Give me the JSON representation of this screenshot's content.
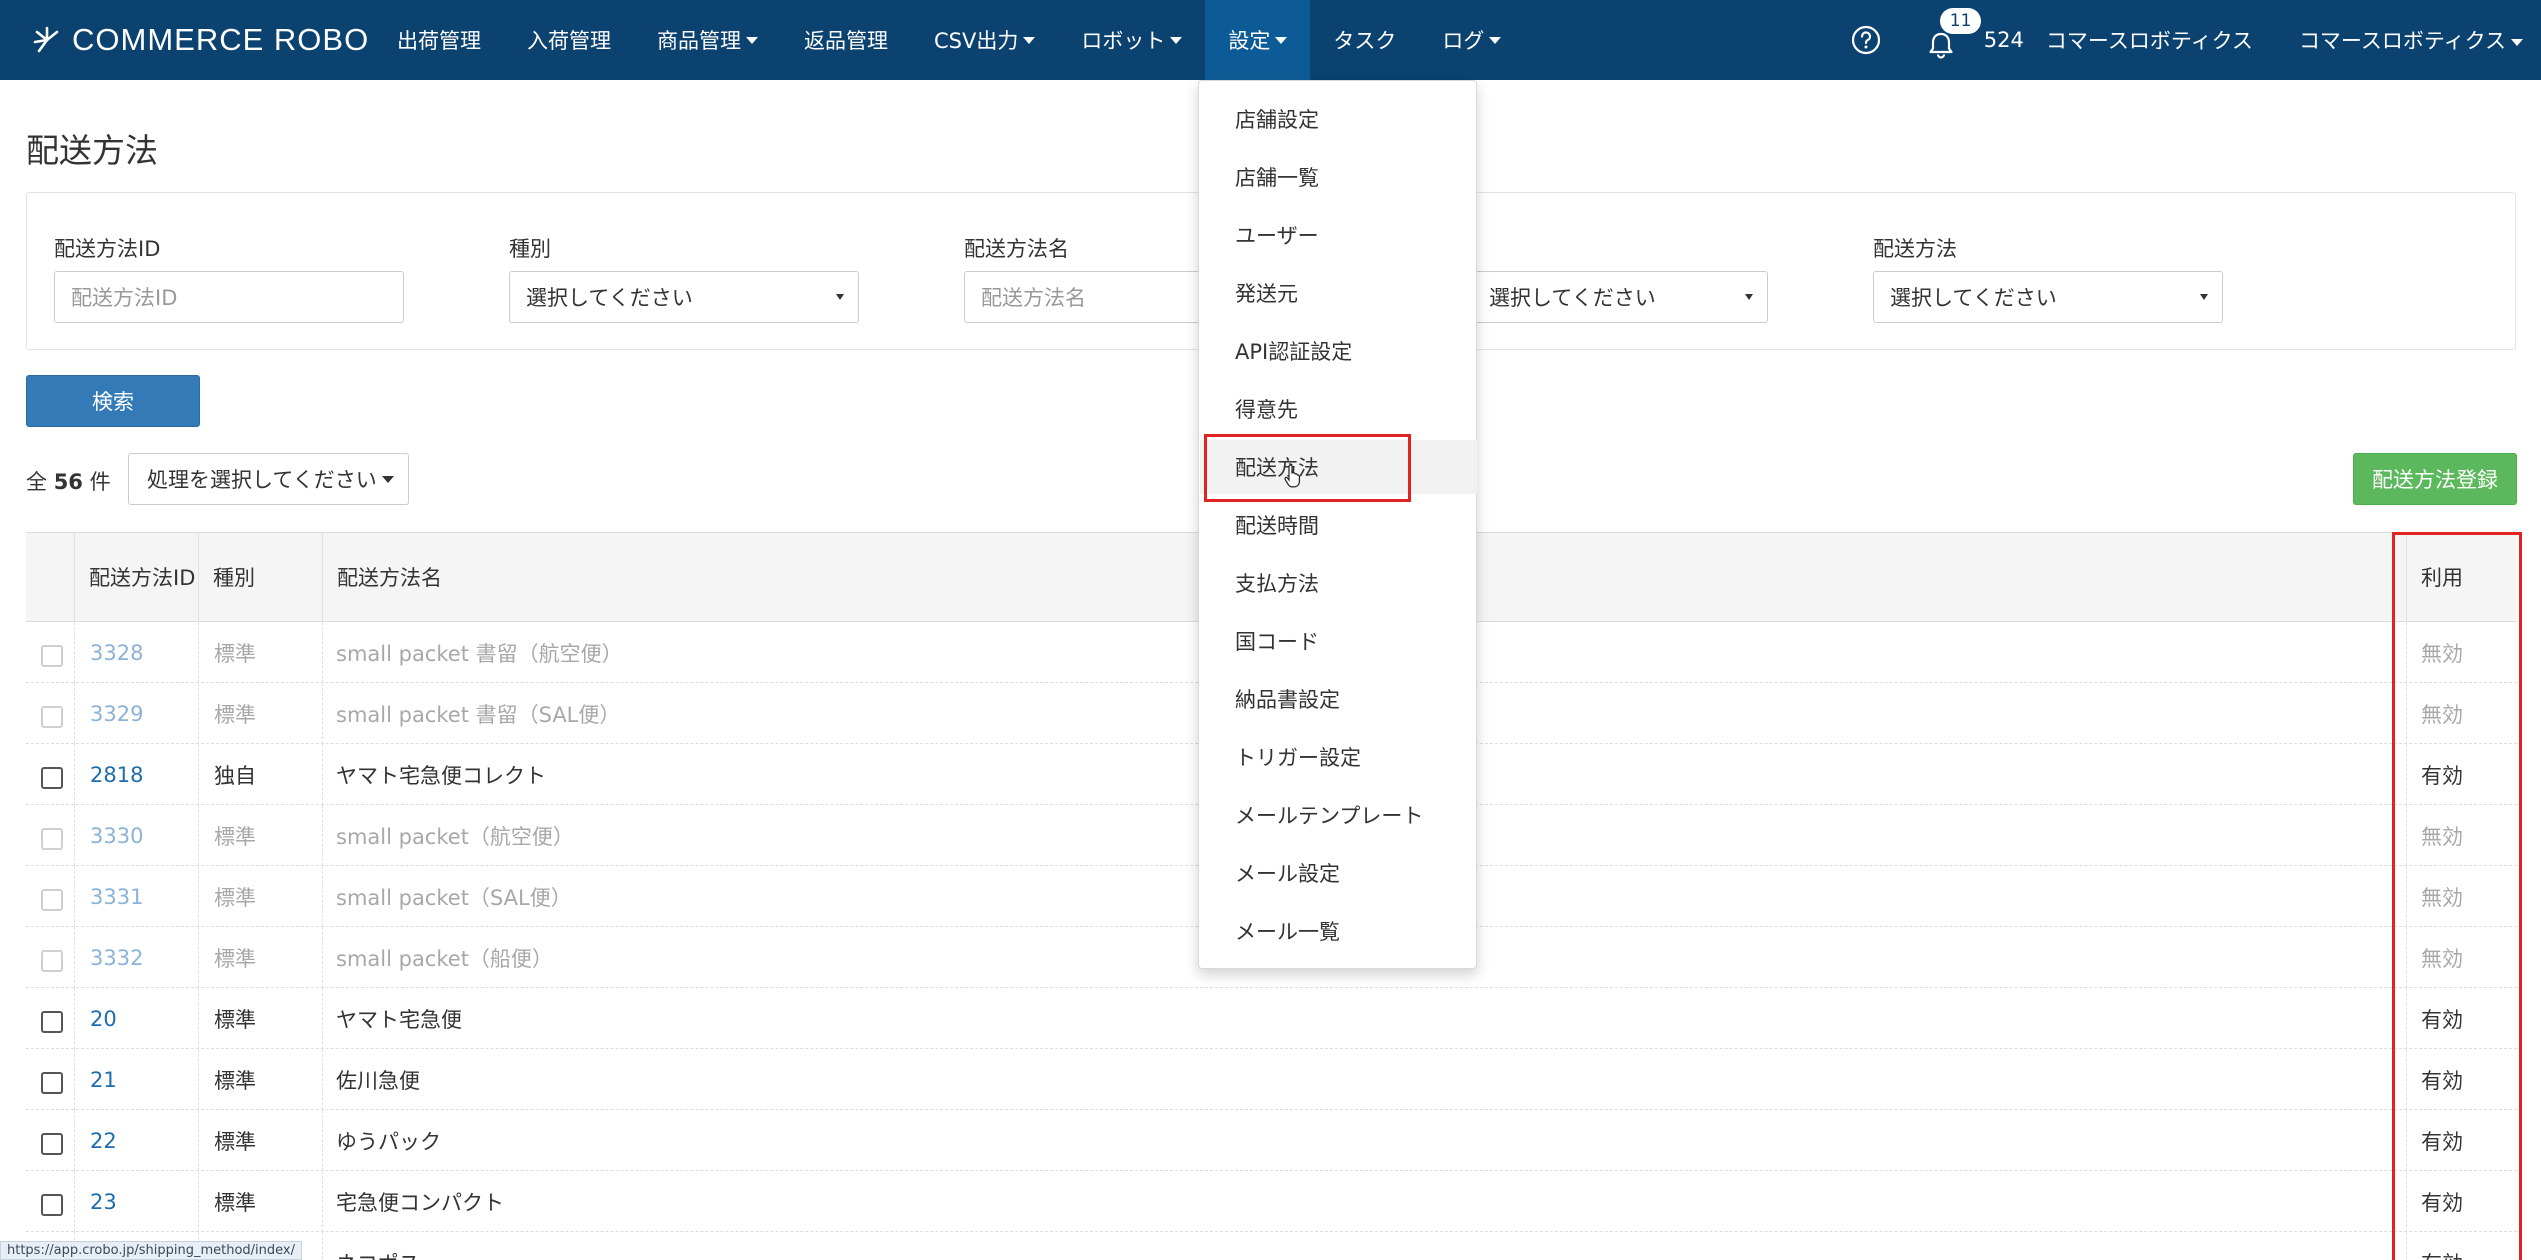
{
  "app": {
    "logo_text": "COMMERCE ROBO",
    "nav": [
      {
        "label": "出荷管理",
        "caret": false
      },
      {
        "label": "入荷管理",
        "caret": false
      },
      {
        "label": "商品管理",
        "caret": true
      },
      {
        "label": "返品管理",
        "caret": false
      },
      {
        "label": "CSV出力",
        "caret": true
      },
      {
        "label": "ロボット",
        "caret": true
      },
      {
        "label": "設定",
        "caret": true,
        "active": true
      },
      {
        "label": "タスク",
        "caret": false
      },
      {
        "label": "ログ",
        "caret": true
      }
    ],
    "notification_count": "11",
    "account_count": "524",
    "company_name": "コマースロボティクス",
    "user_menu": "コマースロボティクス",
    "colors": {
      "navbar": "#0b4270",
      "active_nav": "#0d5b96",
      "primary": "#337ab7",
      "success": "#5cb85c",
      "highlight": "#e02424"
    }
  },
  "page": {
    "title": "配送方法",
    "filters": {
      "id_label": "配送方法ID",
      "id_placeholder": "配送方法ID",
      "type_label": "種別",
      "type_value": "選択してください",
      "name_label": "配送方法名",
      "name_placeholder": "配送方法名",
      "status_value": "選択してください",
      "method_label": "配送方法",
      "method_value": "選択してください"
    },
    "search_button": "検索",
    "total_prefix": "全",
    "total_count": "56",
    "total_suffix": "件",
    "action_select": "処理を選択してください",
    "register_button": "配送方法登録"
  },
  "table": {
    "headers": {
      "id": "配送方法ID",
      "type": "種別",
      "name": "配送方法名",
      "usage": "利用"
    },
    "rows": [
      {
        "id": "3328",
        "type": "標準",
        "name": "small packet 書留（航空便）",
        "usage": "無効",
        "disabled": true
      },
      {
        "id": "3329",
        "type": "標準",
        "name": "small packet 書留（SAL便）",
        "usage": "無効",
        "disabled": true
      },
      {
        "id": "2818",
        "type": "独自",
        "name": "ヤマト宅急便コレクト",
        "usage": "有効",
        "disabled": false
      },
      {
        "id": "3330",
        "type": "標準",
        "name": "small packet（航空便）",
        "usage": "無効",
        "disabled": true
      },
      {
        "id": "3331",
        "type": "標準",
        "name": "small packet（SAL便）",
        "usage": "無効",
        "disabled": true
      },
      {
        "id": "3332",
        "type": "標準",
        "name": "small packet（船便）",
        "usage": "無効",
        "disabled": true
      },
      {
        "id": "20",
        "type": "標準",
        "name": "ヤマト宅急便",
        "usage": "有効",
        "disabled": false
      },
      {
        "id": "21",
        "type": "標準",
        "name": "佐川急便",
        "usage": "有効",
        "disabled": false
      },
      {
        "id": "22",
        "type": "標準",
        "name": "ゆうパック",
        "usage": "有効",
        "disabled": false
      },
      {
        "id": "23",
        "type": "標準",
        "name": "宅急便コンパクト",
        "usage": "有効",
        "disabled": false
      },
      {
        "id": "",
        "type": "",
        "name": "ネコポス",
        "usage": "有効",
        "disabled": false
      }
    ]
  },
  "settings_menu": [
    "店舗設定",
    "店舗一覧",
    "ユーザー",
    "発送元",
    "API認証設定",
    "得意先",
    "配送方法",
    "配送時間",
    "支払方法",
    "国コード",
    "納品書設定",
    "トリガー設定",
    "メールテンプレート",
    "メール設定",
    "メール一覧"
  ],
  "status_bar_url": "https://app.crobo.jp/shipping_method/index/"
}
